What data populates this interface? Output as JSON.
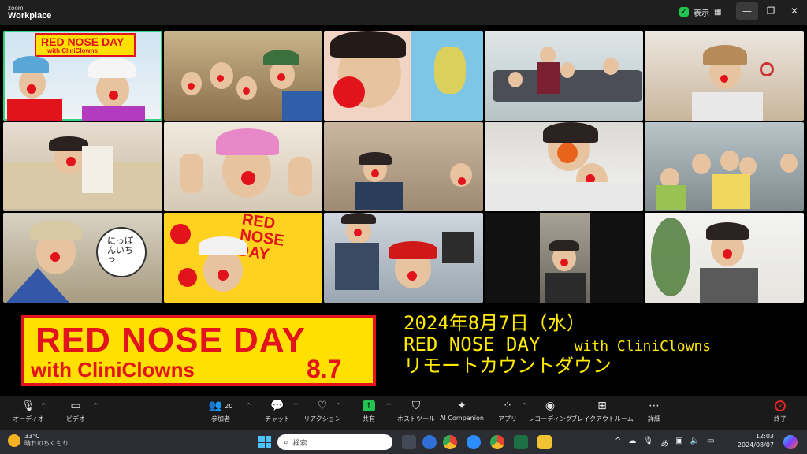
{
  "window": {
    "app_name_top": "zoom",
    "app_name_bottom": "Workplace",
    "view_label": "表示",
    "controls": {
      "minimize": "—",
      "maximize": "❐",
      "close": "✕"
    }
  },
  "colors": {
    "active_border": "#35d07f",
    "share_green": "#23c552",
    "banner_yellow": "#ffe000",
    "banner_red": "#e3131b",
    "event_text": "#ffea00",
    "end_red": "#e02828"
  },
  "gallery": {
    "tile_1_banner_line1": "RED NOSE DAY",
    "tile_1_banner_line2": "with CliniClowns",
    "tile_12_poster": "RED NOSE DAY",
    "tile_11_sign": "にっぽんいちっ"
  },
  "banner": {
    "line1": "RED NOSE DAY",
    "line2": "with CliniClowns",
    "date_short": "8.7"
  },
  "event": {
    "date": "2024年8月7日（水）",
    "title": "RED NOSE DAY",
    "partner": "with CliniClowns",
    "subtitle": "リモートカウントダウン"
  },
  "toolbar": {
    "audio": "オーディオ",
    "video": "ビデオ",
    "participants": "参加者",
    "participants_count": "20",
    "chat": "チャット",
    "reactions": "リアクション",
    "share": "共有",
    "host_tools": "ホストツール",
    "ai_companion": "AI Companion",
    "apps": "アプリ",
    "recording": "レコーディング",
    "breakout": "ブレイクアウトルーム",
    "more": "詳細",
    "end": "終了"
  },
  "taskbar": {
    "temperature": "33°C",
    "weather": "晴れのちくもり",
    "search_placeholder": "検索",
    "ime": "あ",
    "time": "12:03",
    "date": "2024/08/07"
  }
}
